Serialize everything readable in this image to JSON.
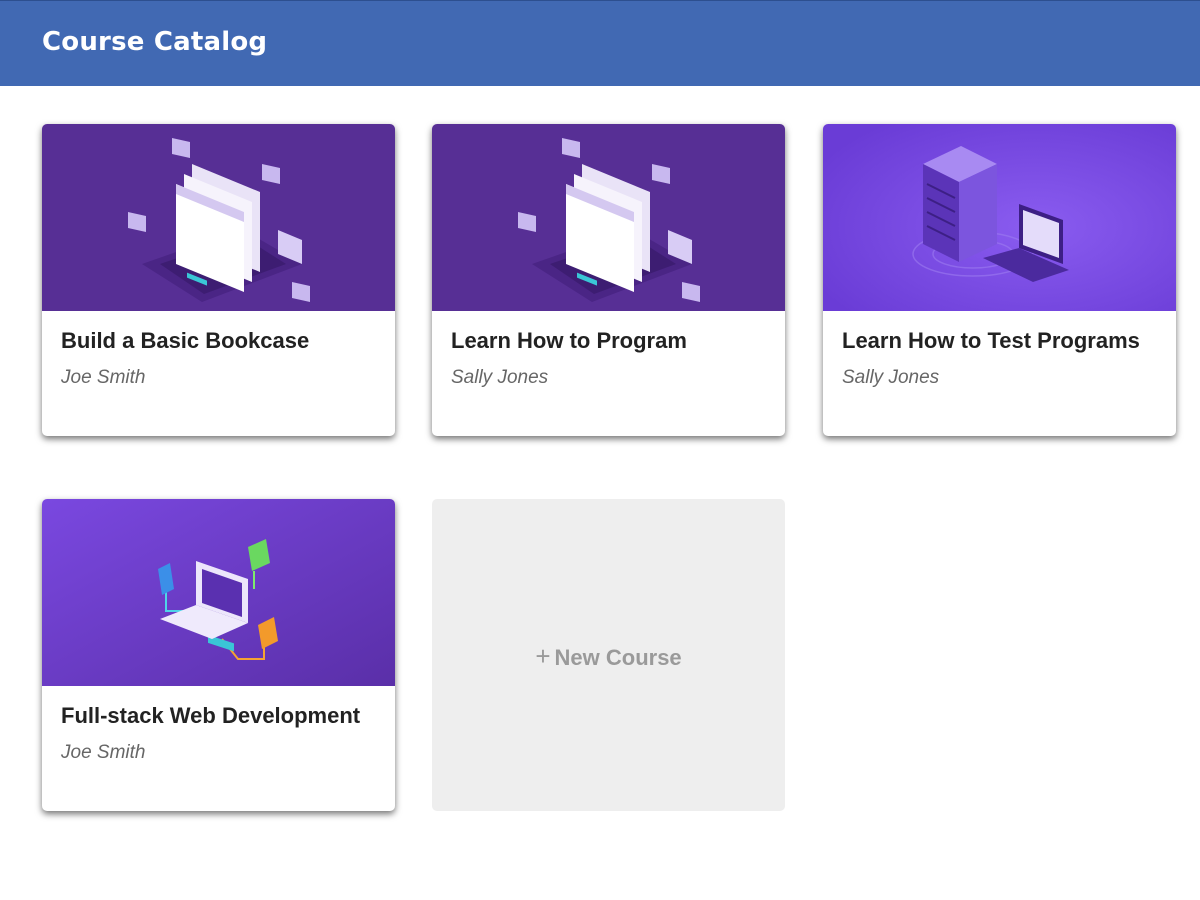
{
  "header": {
    "title": "Course Catalog",
    "color": "#4169b3"
  },
  "courses": [
    {
      "title": "Build a Basic Bookcase",
      "author": "Joe Smith",
      "illustration": "laptop-windows-envelopes-illustration"
    },
    {
      "title": "Learn How to Program",
      "author": "Sally Jones",
      "illustration": "laptop-windows-envelopes-illustration"
    },
    {
      "title": "Learn How to Test Programs",
      "author": "Sally Jones",
      "illustration": "server-laptop-illustration"
    },
    {
      "title": "Full-stack Web Development",
      "author": "Joe Smith",
      "illustration": "laptop-network-illustration"
    }
  ],
  "new_course": {
    "icon": "plus-icon",
    "label": "New Course"
  },
  "colors": {
    "thumb_purple_dark": "#572f95",
    "thumb_purple_light": "#7b4be0",
    "placeholder_gray": "#eeeeee"
  }
}
